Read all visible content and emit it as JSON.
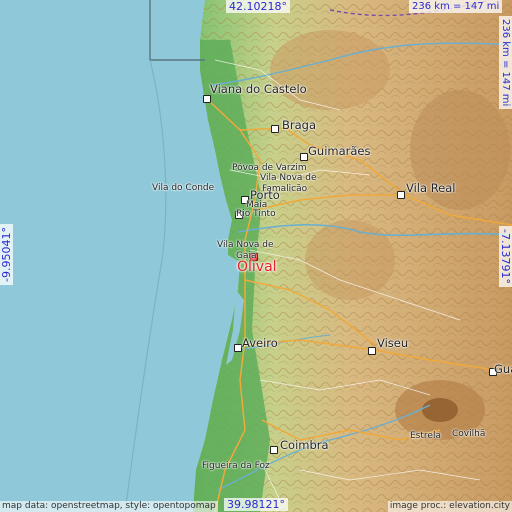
{
  "map": {
    "highlight": {
      "name": "Olival",
      "color": "#e8202a"
    },
    "places": [
      {
        "id": "viana",
        "name": "Viana do Castelo"
      },
      {
        "id": "braga",
        "name": "Braga"
      },
      {
        "id": "guimaraes",
        "name": "Guimarães"
      },
      {
        "id": "povoa",
        "name": "Póvoa de Varzim"
      },
      {
        "id": "famalicao1",
        "name": "Vila Nova de"
      },
      {
        "id": "famalicao2",
        "name": "Famalicão"
      },
      {
        "id": "viladoconde",
        "name": "Vila do Conde"
      },
      {
        "id": "maia",
        "name": "Maia"
      },
      {
        "id": "porto",
        "name": "Porto"
      },
      {
        "id": "riotinto",
        "name": "Rio Tinto"
      },
      {
        "id": "gaia1",
        "name": "Vila Nova de"
      },
      {
        "id": "gaia2",
        "name": "Gaia"
      },
      {
        "id": "vilareal",
        "name": "Vila Real"
      },
      {
        "id": "aveiro",
        "name": "Aveiro"
      },
      {
        "id": "viseu",
        "name": "Viseu"
      },
      {
        "id": "guarda",
        "name": "Gua"
      },
      {
        "id": "estrela",
        "name": "Estrela"
      },
      {
        "id": "covilha",
        "name": "Covilhã"
      },
      {
        "id": "coimbra",
        "name": "Coimbra"
      },
      {
        "id": "figueira",
        "name": "Figueira da Foz"
      }
    ],
    "coords": {
      "top": "42.10218°",
      "bottom": "39.98121°",
      "left": "-9.95041°",
      "right": "-7.13791°"
    },
    "scale": {
      "horizontal": "236 km = 147 mi",
      "vertical": "236 km = 147 mi"
    },
    "credits": {
      "left": "map data: openstreetmap, style: opentopomap",
      "right": "image proc.: elevation.city"
    },
    "colors": {
      "sea": "#8fc9d9",
      "lowland": "#5fae5a",
      "highland": "#d9b981",
      "mountain": "#b5824a",
      "coord_text": "#2a2ad0"
    }
  }
}
